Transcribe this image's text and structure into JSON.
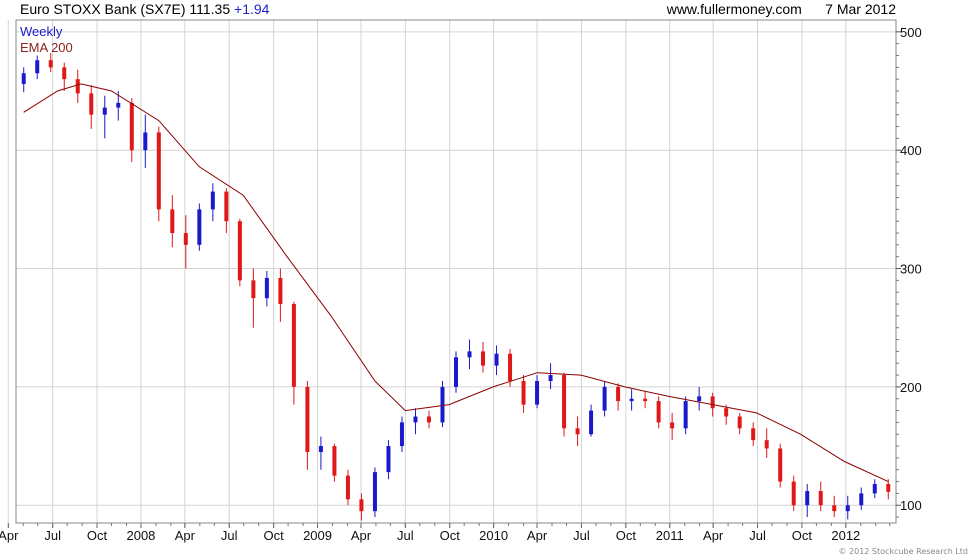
{
  "header": {
    "title": "Euro STOXX Bank (SX7E)",
    "last": "111.35",
    "change": "+1.94",
    "source": "www.fullermoney.com",
    "date": "7 Mar 2012"
  },
  "credit": "© 2012 Stockcube Research Ltd",
  "colors": {
    "up_candle": "#1a1acc",
    "down_candle": "#e01818",
    "ema_line": "#8b0000",
    "grid": "#d4d4d4",
    "legend_weekly": "#1a1acc",
    "legend_ema": "#8b2323"
  },
  "chart_data": {
    "type": "candlestick",
    "timeframe": "Weekly",
    "y_axis_side": "right",
    "ylim": [
      85,
      510
    ],
    "y_ticks": [
      100,
      200,
      300,
      400,
      500
    ],
    "x_ticks": [
      "Apr",
      "Jul",
      "Oct",
      "2008",
      "Apr",
      "Jul",
      "Oct",
      "2009",
      "Apr",
      "Jul",
      "Oct",
      "2010",
      "Apr",
      "Jul",
      "Oct",
      "2011",
      "Apr",
      "Jul",
      "Oct",
      "2012"
    ],
    "grid": true,
    "legend": {
      "position": "top-left",
      "entries": [
        "Weekly",
        "EMA 200"
      ]
    },
    "series": [
      {
        "name": "Weekly",
        "kind": "candles",
        "points": [
          [
            "2007-04-02",
            456,
            470,
            449,
            465
          ],
          [
            "2007-04-30",
            465,
            480,
            460,
            476
          ],
          [
            "2007-05-28",
            476,
            482,
            466,
            470
          ],
          [
            "2007-06-25",
            470,
            474,
            450,
            460
          ],
          [
            "2007-07-23",
            460,
            468,
            440,
            448
          ],
          [
            "2007-08-20",
            448,
            455,
            418,
            430
          ],
          [
            "2007-09-17",
            430,
            446,
            410,
            436
          ],
          [
            "2007-10-15",
            436,
            450,
            425,
            440
          ],
          [
            "2007-11-12",
            440,
            444,
            390,
            400
          ],
          [
            "2007-12-10",
            400,
            430,
            385,
            415
          ],
          [
            "2008-01-07",
            415,
            420,
            340,
            350
          ],
          [
            "2008-02-04",
            350,
            362,
            318,
            330
          ],
          [
            "2008-03-03",
            330,
            345,
            300,
            320
          ],
          [
            "2008-03-31",
            320,
            355,
            315,
            350
          ],
          [
            "2008-04-28",
            350,
            372,
            340,
            365
          ],
          [
            "2008-05-26",
            365,
            368,
            330,
            340
          ],
          [
            "2008-06-23",
            340,
            342,
            285,
            290
          ],
          [
            "2008-07-21",
            290,
            300,
            250,
            275
          ],
          [
            "2008-08-18",
            275,
            298,
            268,
            292
          ],
          [
            "2008-09-15",
            292,
            300,
            255,
            270
          ],
          [
            "2008-10-13",
            270,
            272,
            185,
            200
          ],
          [
            "2008-11-10",
            200,
            205,
            130,
            145
          ],
          [
            "2008-12-08",
            145,
            158,
            130,
            150
          ],
          [
            "2009-01-05",
            150,
            152,
            120,
            125
          ],
          [
            "2009-02-02",
            125,
            130,
            100,
            105
          ],
          [
            "2009-03-02",
            105,
            110,
            87,
            95
          ],
          [
            "2009-03-30",
            95,
            132,
            90,
            128
          ],
          [
            "2009-04-27",
            128,
            155,
            122,
            150
          ],
          [
            "2009-05-25",
            150,
            175,
            145,
            170
          ],
          [
            "2009-06-22",
            170,
            182,
            160,
            175
          ],
          [
            "2009-07-20",
            175,
            180,
            165,
            170
          ],
          [
            "2009-08-17",
            170,
            205,
            166,
            200
          ],
          [
            "2009-09-14",
            200,
            230,
            195,
            225
          ],
          [
            "2009-10-12",
            225,
            240,
            215,
            230
          ],
          [
            "2009-11-09",
            230,
            238,
            212,
            218
          ],
          [
            "2009-12-07",
            218,
            235,
            210,
            228
          ],
          [
            "2010-01-04",
            228,
            232,
            200,
            205
          ],
          [
            "2010-02-01",
            205,
            210,
            178,
            185
          ],
          [
            "2010-03-01",
            185,
            210,
            182,
            205
          ],
          [
            "2010-03-29",
            205,
            220,
            198,
            210
          ],
          [
            "2010-04-26",
            210,
            212,
            158,
            165
          ],
          [
            "2010-05-24",
            165,
            175,
            150,
            160
          ],
          [
            "2010-06-21",
            160,
            185,
            158,
            180
          ],
          [
            "2010-07-19",
            180,
            205,
            175,
            200
          ],
          [
            "2010-08-16",
            200,
            203,
            180,
            188
          ],
          [
            "2010-09-13",
            188,
            198,
            180,
            190
          ],
          [
            "2010-10-11",
            190,
            196,
            182,
            188
          ],
          [
            "2010-11-08",
            188,
            192,
            165,
            170
          ],
          [
            "2010-12-06",
            170,
            178,
            155,
            165
          ],
          [
            "2011-01-03",
            165,
            192,
            160,
            188
          ],
          [
            "2011-01-31",
            188,
            200,
            180,
            192
          ],
          [
            "2011-02-28",
            192,
            195,
            175,
            182
          ],
          [
            "2011-03-28",
            182,
            185,
            168,
            175
          ],
          [
            "2011-04-25",
            175,
            178,
            160,
            165
          ],
          [
            "2011-05-23",
            165,
            170,
            150,
            155
          ],
          [
            "2011-06-20",
            155,
            165,
            140,
            148
          ],
          [
            "2011-07-18",
            148,
            152,
            115,
            120
          ],
          [
            "2011-08-15",
            120,
            125,
            95,
            100
          ],
          [
            "2011-09-12",
            100,
            118,
            90,
            112
          ],
          [
            "2011-10-10",
            112,
            120,
            95,
            100
          ],
          [
            "2011-11-07",
            100,
            108,
            90,
            95
          ],
          [
            "2011-12-05",
            95,
            108,
            88,
            100
          ],
          [
            "2012-01-02",
            100,
            115,
            96,
            110
          ],
          [
            "2012-01-30",
            110,
            122,
            106,
            118
          ],
          [
            "2012-02-27",
            118,
            122,
            105,
            111.35
          ]
        ]
      },
      {
        "name": "EMA 200",
        "kind": "line",
        "points": [
          [
            "2007-04-02",
            432
          ],
          [
            "2007-06-11",
            450
          ],
          [
            "2007-07-30",
            456
          ],
          [
            "2007-10-01",
            450
          ],
          [
            "2008-01-07",
            425
          ],
          [
            "2008-03-31",
            386
          ],
          [
            "2008-06-30",
            362
          ],
          [
            "2008-09-29",
            310
          ],
          [
            "2008-12-29",
            260
          ],
          [
            "2009-03-30",
            205
          ],
          [
            "2009-06-01",
            180
          ],
          [
            "2009-08-31",
            185
          ],
          [
            "2009-11-30",
            200
          ],
          [
            "2010-03-01",
            212
          ],
          [
            "2010-05-31",
            210
          ],
          [
            "2010-08-30",
            200
          ],
          [
            "2010-11-29",
            192
          ],
          [
            "2011-02-28",
            185
          ],
          [
            "2011-05-30",
            178
          ],
          [
            "2011-08-29",
            160
          ],
          [
            "2011-11-28",
            137
          ],
          [
            "2012-02-27",
            120
          ]
        ]
      }
    ]
  }
}
